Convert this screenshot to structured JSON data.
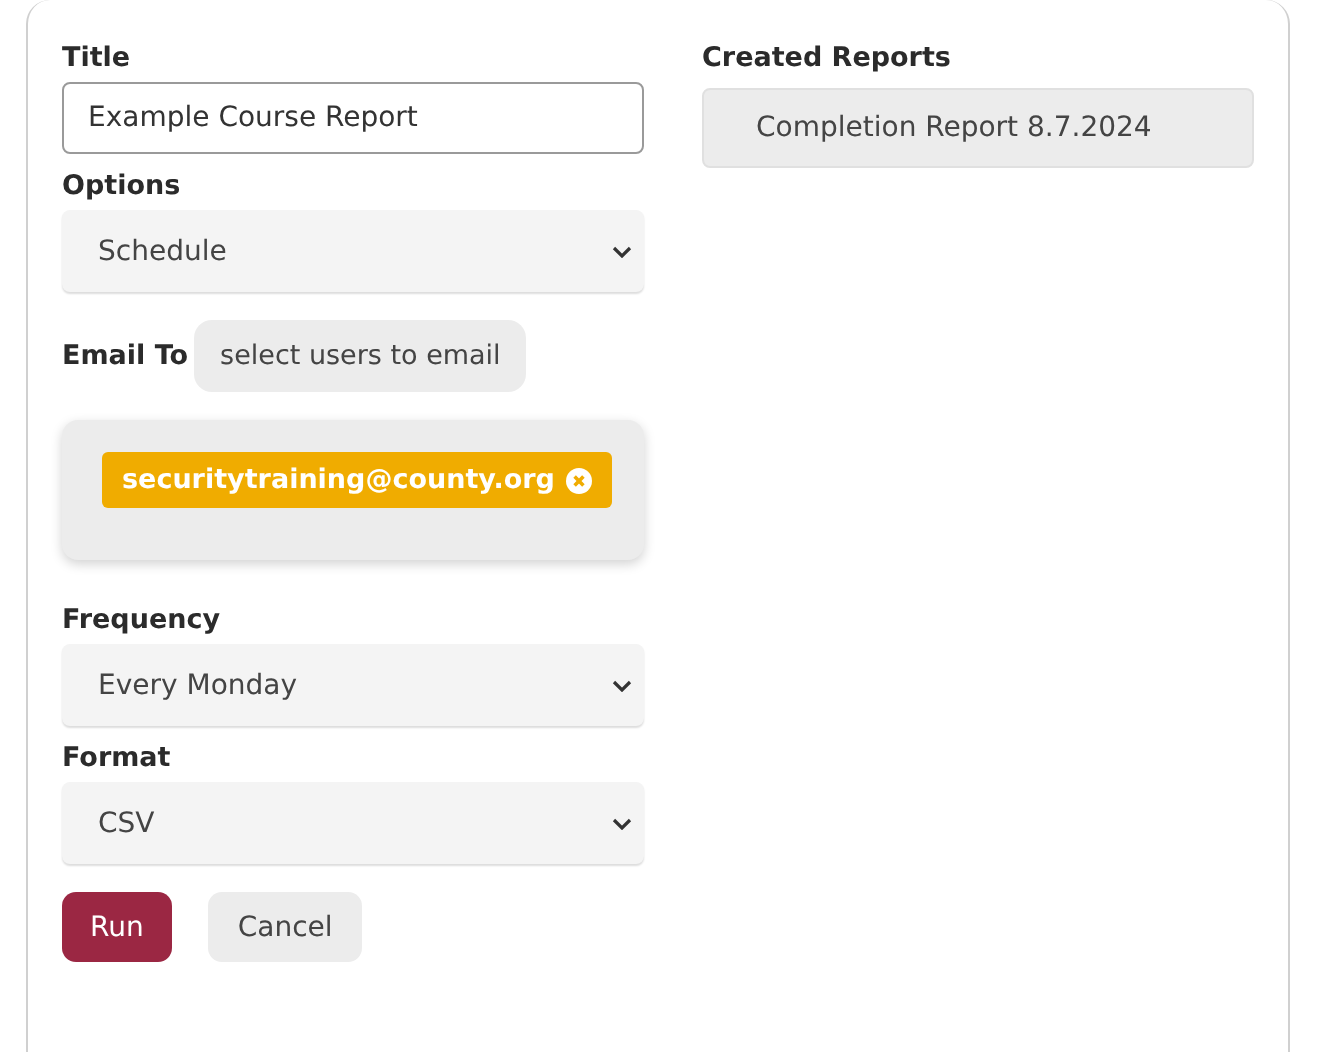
{
  "fields": [
    {
      "kind": "text",
      "label": "Title",
      "value": "Example Course Report"
    },
    {
      "kind": "select",
      "label": "Options",
      "value": "Schedule"
    },
    {
      "kind": "recipients",
      "label": "Email To",
      "button": "select users to email",
      "recipients": [
        "securitytraining@county.org"
      ]
    },
    {
      "kind": "select",
      "label": "Frequency",
      "value": "Every Monday"
    },
    {
      "kind": "select",
      "label": "Format",
      "value": "CSV"
    }
  ],
  "buttons": [
    {
      "label": "Run",
      "kind": "primary"
    },
    {
      "label": "Cancel",
      "kind": "secondary"
    }
  ],
  "created_reports": {
    "label": "Created Reports",
    "items": [
      "Completion Report 8.7.2024"
    ]
  }
}
